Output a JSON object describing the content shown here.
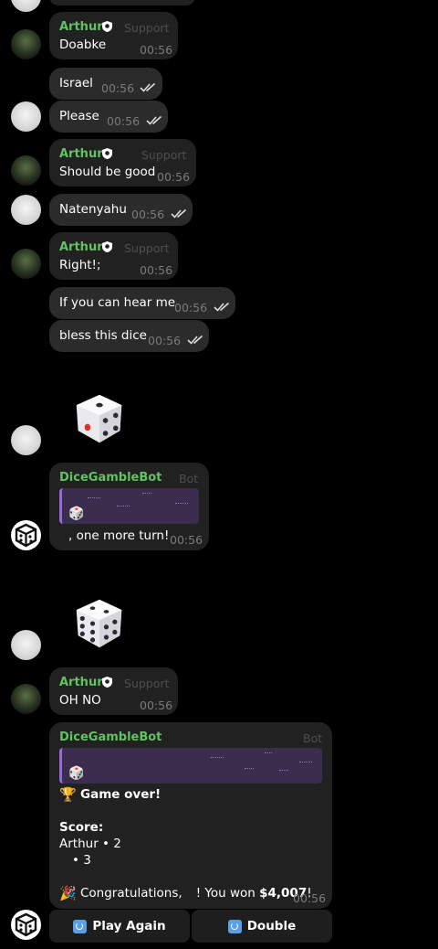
{
  "colors": {
    "background": "#000000",
    "bubble": "#212121",
    "name_green": "#63c261",
    "quote_border": "#9a6bd8"
  },
  "messages": {
    "m1": {
      "sender": "Arthur",
      "tag": "Support",
      "text": "Doabke",
      "time": "00:56"
    },
    "m2": {
      "text": "Israel",
      "time": "00:56"
    },
    "m3": {
      "text": "Please",
      "time": "00:56"
    },
    "m4": {
      "sender": "Arthur",
      "tag": "Support",
      "text": "Should be good",
      "time": "00:56"
    },
    "m5": {
      "text": "Natenyahu",
      "time": "00:56"
    },
    "m6": {
      "sender": "Arthur",
      "tag": "Support",
      "text": "Right!;",
      "time": "00:56"
    },
    "m7": {
      "text": "If you can hear me",
      "time": "00:56"
    },
    "m8": {
      "text": "bless this dice",
      "time": "00:56"
    },
    "m9": {
      "sender": "DiceGambleBot",
      "tag": "Bot",
      "text": ", one more turn!",
      "time": "00:56"
    },
    "m10": {
      "sender": "Arthur",
      "tag": "Support",
      "text": "OH NO",
      "time": "00:56"
    },
    "m11": {
      "sender": "DiceGambleBot",
      "tag": "Bot",
      "line1": "Game over!",
      "line2": "Score:",
      "line3": "Arthur • 2",
      "line4": "• 3",
      "line5_pre": "Congratulations,",
      "line5_mid": "! You won ",
      "line5_amount": "$4,007",
      "line5_post": "!",
      "time": "00:56"
    }
  },
  "keyboard": {
    "play_again": "Play Again",
    "double": "Double"
  },
  "icons": [
    "dice-emoji",
    "shield-icon",
    "double-check-icon",
    "trophy-icon",
    "party-icon",
    "repeat-icon"
  ]
}
